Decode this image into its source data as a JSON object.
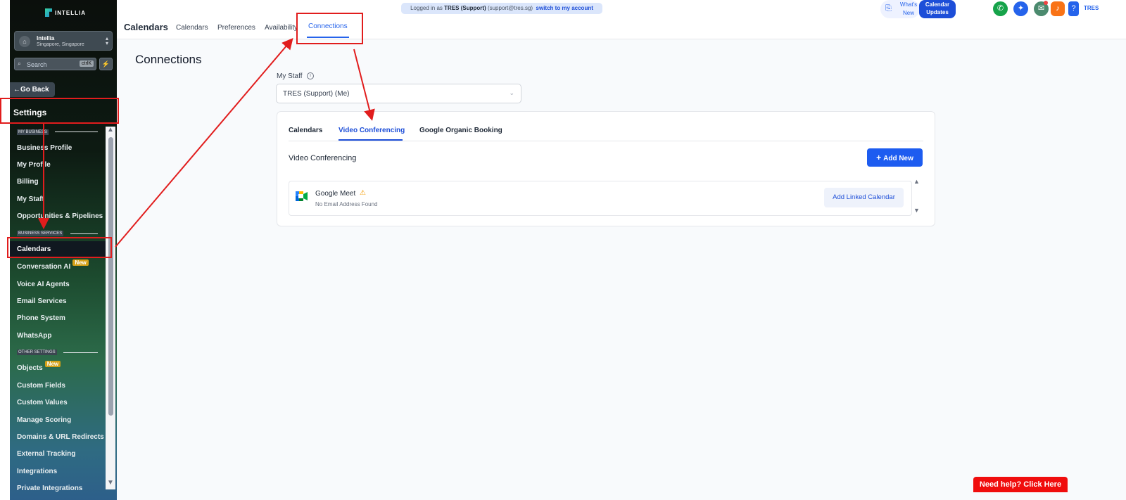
{
  "sidebar": {
    "brand": "INTELLIA",
    "account": {
      "name": "Intellia",
      "location": "Singapore, Singapore"
    },
    "search": {
      "placeholder": "Search",
      "shortcut": "ctrlK"
    },
    "go_back": "Go Back",
    "title": "Settings",
    "sections": {
      "my_business": "MY BUSINESS",
      "business_services": "BUSINESS SERVICES",
      "other_settings": "OTHER SETTINGS"
    },
    "items": [
      {
        "label": "Business Profile"
      },
      {
        "label": "My Profile"
      },
      {
        "label": "Billing"
      },
      {
        "label": "My Staff"
      },
      {
        "label": "Opportunities & Pipelines"
      },
      {
        "label": "Calendars"
      },
      {
        "label": "Conversation AI",
        "badge": "New"
      },
      {
        "label": "Voice AI Agents"
      },
      {
        "label": "Email Services"
      },
      {
        "label": "Phone System"
      },
      {
        "label": "WhatsApp"
      },
      {
        "label": "Objects",
        "badge": "New"
      },
      {
        "label": "Custom Fields"
      },
      {
        "label": "Custom Values"
      },
      {
        "label": "Manage Scoring"
      },
      {
        "label": "Domains & URL Redirects"
      },
      {
        "label": "External Tracking"
      },
      {
        "label": "Integrations"
      },
      {
        "label": "Private Integrations"
      }
    ],
    "active_item": "Calendars"
  },
  "topbar": {
    "title": "Calendars",
    "tabs": [
      {
        "label": "Calendars"
      },
      {
        "label": "Preferences"
      },
      {
        "label": "Availability"
      },
      {
        "label": "Connections"
      }
    ],
    "active_tab": "Connections",
    "login_banner": {
      "prefix": "Logged in as",
      "user": "TRES (Support)",
      "email": "(support@tres.sg)",
      "switch": "switch to my account"
    },
    "whats_new": {
      "line1": "What's",
      "line2": "New"
    },
    "calendar_updates": {
      "line1": "Calendar",
      "line2": "Updates"
    },
    "icons": [
      "phone-icon",
      "magic-icon",
      "megaphone-icon",
      "bell-icon",
      "help-icon"
    ],
    "user_initials": "TRES"
  },
  "main": {
    "title": "Connections",
    "staff_label": "My Staff",
    "staff_value": "TRES (Support) (Me)",
    "tabs": [
      {
        "label": "Calendars"
      },
      {
        "label": "Video Conferencing"
      },
      {
        "label": "Google Organic Booking"
      }
    ],
    "active_tab": "Video Conferencing",
    "section_title": "Video Conferencing",
    "add_new": "Add New",
    "connection": {
      "name": "Google Meet",
      "status": "No Email Address Found",
      "action": "Add Linked Calendar"
    }
  },
  "help_button": "Need help? Click Here",
  "colors": {
    "accent": "#1d4ed8",
    "annotation": "#e11d1d",
    "help": "#f00d0d"
  }
}
